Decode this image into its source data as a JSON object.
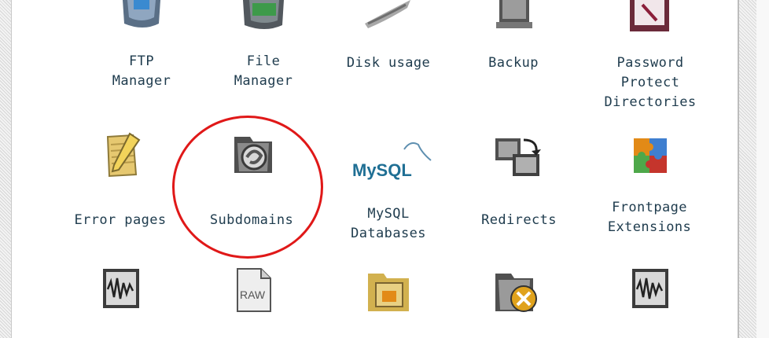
{
  "icons": {
    "row1": [
      {
        "label_lines": [
          "FTP",
          "Manager"
        ],
        "icon": "ftp-folder-icon"
      },
      {
        "label_lines": [
          "File",
          "Manager"
        ],
        "icon": "file-manager-folder-icon"
      },
      {
        "label_lines": [
          "Disk usage"
        ],
        "icon": "disk-usage-icon"
      },
      {
        "label_lines": [
          "Backup"
        ],
        "icon": "backup-icon"
      },
      {
        "label_lines": [
          "Password",
          "Protect",
          "Directories"
        ],
        "icon": "password-protect-icon"
      }
    ],
    "row2": [
      {
        "label_lines": [
          "Error pages"
        ],
        "icon": "error-pages-notepad-icon"
      },
      {
        "label_lines": [
          "Subdomains"
        ],
        "icon": "subdomains-folder-icon"
      },
      {
        "label_lines": [
          "MySQL",
          "Databases"
        ],
        "icon": "mysql-logo-icon",
        "logo_text": "MySQL"
      },
      {
        "label_lines": [
          "Redirects"
        ],
        "icon": "redirects-icon"
      },
      {
        "label_lines": [
          "Frontpage",
          "Extensions"
        ],
        "icon": "frontpage-puzzle-icon"
      }
    ],
    "row3": [
      {
        "icon": "waveform-icon"
      },
      {
        "icon": "raw-file-icon",
        "badge_text": "RAW"
      },
      {
        "icon": "image-folder-icon"
      },
      {
        "icon": "delete-folder-icon"
      },
      {
        "icon": "waveform-icon"
      }
    ]
  },
  "highlight": {
    "target": "Subdomains",
    "color": "#e01818"
  }
}
